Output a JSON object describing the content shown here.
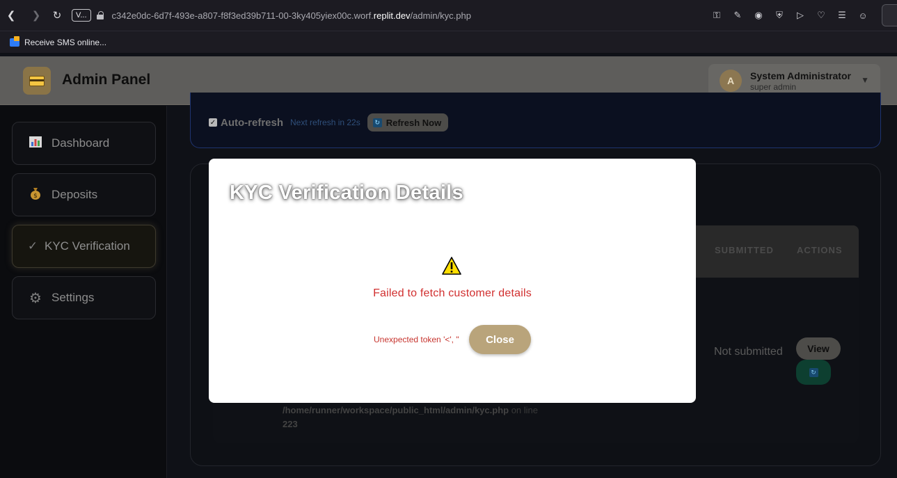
{
  "browser": {
    "version_badge": "V...",
    "url_prefix": "c342e0dc-6d7f-493e-a807-f8f3ed39b711-00-3ky405yiex00c.worf.",
    "url_host": "replit.dev",
    "url_path": "/admin/kyc.php",
    "bookmark_label": "Receive SMS online..."
  },
  "header": {
    "title": "Admin Panel",
    "user_initial": "A",
    "user_name": "System Administrator",
    "user_role": "super admin"
  },
  "sidebar": {
    "items": [
      {
        "label": "Dashboard",
        "icon": "chart-icon"
      },
      {
        "label": "Deposits",
        "icon": "money-bag-icon"
      },
      {
        "label": "KYC Verification",
        "icon": "check-icon",
        "active": true
      },
      {
        "label": "Settings",
        "icon": "gear-icon"
      }
    ]
  },
  "toolbar": {
    "auto_refresh_label": "Auto-refresh",
    "auto_refresh_checked": true,
    "next_refresh": "Next refresh in 22s",
    "refresh_button": "Refresh Now"
  },
  "table": {
    "headers": [
      "SUBMITTED",
      "ACTIONS"
    ],
    "row": {
      "status": "Not submitted",
      "view_button": "View",
      "error_path": "/home/runner/workspace/public_html/admin/kyc.php",
      "error_on_line": "on line",
      "error_line": "223"
    }
  },
  "modal": {
    "title": "KYC Verification Details",
    "message": "Failed to fetch customer details",
    "detail": "Unexpected token '<', \"",
    "close_button": "Close",
    "warning_icon": "warning-icon",
    "accent": "#b9a47b",
    "error_color": "#d12f2f"
  }
}
